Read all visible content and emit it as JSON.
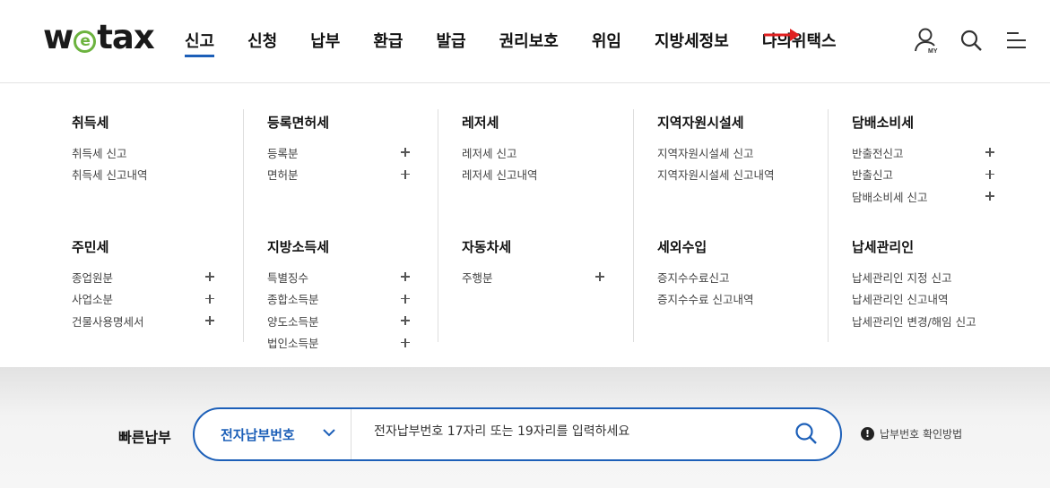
{
  "logo": {
    "pre": "w",
    "mid": "e",
    "post": "tax"
  },
  "nav": [
    "신고",
    "신청",
    "납부",
    "환급",
    "발급",
    "권리보호",
    "위임",
    "지방세정보",
    "나의위택스"
  ],
  "menu": [
    {
      "groups": [
        {
          "title": "취득세",
          "items": [
            {
              "label": "취득세 신고",
              "plus": false
            },
            {
              "label": "취득세 신고내역",
              "plus": false
            }
          ]
        },
        {
          "title": "주민세",
          "items": [
            {
              "label": "종업원분",
              "plus": true
            },
            {
              "label": "사업소분",
              "plus": true
            },
            {
              "label": "건물사용명세서",
              "plus": true
            }
          ]
        }
      ]
    },
    {
      "groups": [
        {
          "title": "등록면허세",
          "items": [
            {
              "label": "등록분",
              "plus": true
            },
            {
              "label": "면허분",
              "plus": true
            }
          ]
        },
        {
          "title": "지방소득세",
          "items": [
            {
              "label": "특별징수",
              "plus": true
            },
            {
              "label": "종합소득분",
              "plus": true
            },
            {
              "label": "양도소득분",
              "plus": true
            },
            {
              "label": "법인소득분",
              "plus": true
            }
          ]
        }
      ]
    },
    {
      "groups": [
        {
          "title": "레저세",
          "items": [
            {
              "label": "레저세 신고",
              "plus": false
            },
            {
              "label": "레저세 신고내역",
              "plus": false
            }
          ]
        },
        {
          "title": "자동차세",
          "items": [
            {
              "label": "주행분",
              "plus": true
            }
          ]
        }
      ]
    },
    {
      "groups": [
        {
          "title": "지역자원시설세",
          "items": [
            {
              "label": "지역자원시설세 신고",
              "plus": false
            },
            {
              "label": "지역자원시설세 신고내역",
              "plus": false
            }
          ]
        },
        {
          "title": "세외수입",
          "items": [
            {
              "label": "증지수수료신고",
              "plus": false
            },
            {
              "label": "증지수수료 신고내역",
              "plus": false
            }
          ]
        }
      ]
    },
    {
      "groups": [
        {
          "title": "담배소비세",
          "items": [
            {
              "label": "반출전신고",
              "plus": true
            },
            {
              "label": "반출신고",
              "plus": true
            },
            {
              "label": "담배소비세 신고",
              "plus": true
            }
          ]
        },
        {
          "title": "납세관리인",
          "items": [
            {
              "label": "납세관리인 지정 신고",
              "plus": false
            },
            {
              "label": "납세관리인 신고내역",
              "plus": false
            },
            {
              "label": "납세관리인 변경/해임 신고",
              "plus": false
            }
          ]
        }
      ]
    }
  ],
  "quickpay": {
    "label": "빠른납부",
    "select": "전자납부번호",
    "placeholder": "전자납부번호 17자리 또는 19자리를 입력하세요",
    "help": "납부번호 확인방법"
  },
  "colors": {
    "accent": "#1c5fb8",
    "logo_green": "#6cb33f",
    "arrow": "#e02020"
  },
  "icons": [
    "my-page-icon",
    "search-icon",
    "menu-icon",
    "chevron-down-icon",
    "info-icon",
    "red-arrow-icon"
  ]
}
